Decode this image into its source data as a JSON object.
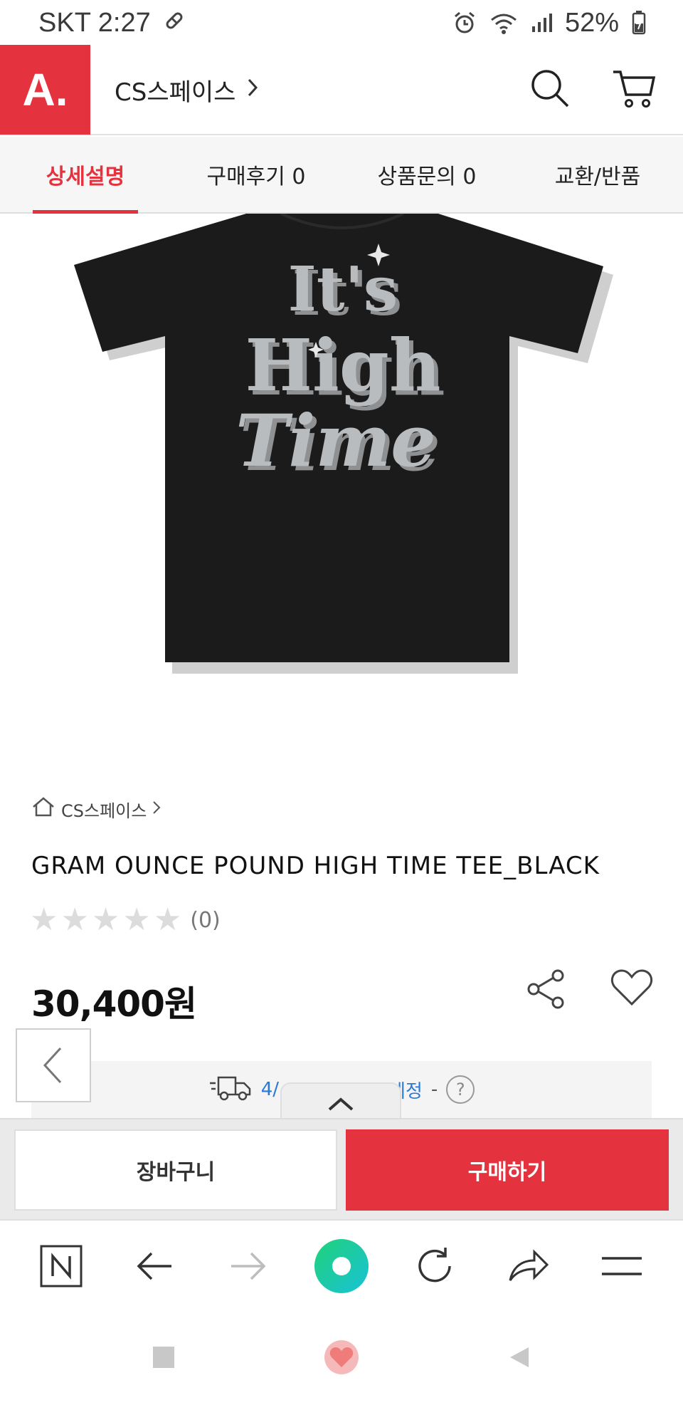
{
  "status_bar": {
    "carrier_time": "SKT 2:27",
    "battery": "52%"
  },
  "header": {
    "logo": "A.",
    "store_name": "CS스페이스"
  },
  "tabs": [
    {
      "label": "상세설명",
      "active": true
    },
    {
      "label": "구매후기 0",
      "active": false
    },
    {
      "label": "상품문의 0",
      "active": false
    },
    {
      "label": "교환/반품",
      "active": false
    }
  ],
  "product": {
    "image_text": [
      "It's",
      "High",
      "Time"
    ],
    "breadcrumb": "CS스페이스",
    "title": "GRAM OUNCE POUND HIGH TIME TEE_BLACK",
    "rating_stars": 0,
    "review_count": "(0)",
    "price": "30,400원"
  },
  "delivery": {
    "date_text": "4/",
    "suffix": "예정",
    "dash": "-",
    "help": "?"
  },
  "actions": {
    "cart_label": "장바구니",
    "buy_label": "구매하기"
  },
  "colors": {
    "accent": "#e5323f",
    "link": "#2a78d8",
    "shirt": "#1b1b1b",
    "print": "#b9bcbe"
  },
  "icons": {
    "browser": [
      "naver-n-icon",
      "back-arrow-icon",
      "forward-arrow-icon",
      "home-circle-icon",
      "refresh-icon",
      "share-arrow-icon",
      "menu-icon"
    ],
    "system": [
      "recent-apps-icon",
      "home-heart-icon",
      "back-triangle-icon"
    ]
  }
}
